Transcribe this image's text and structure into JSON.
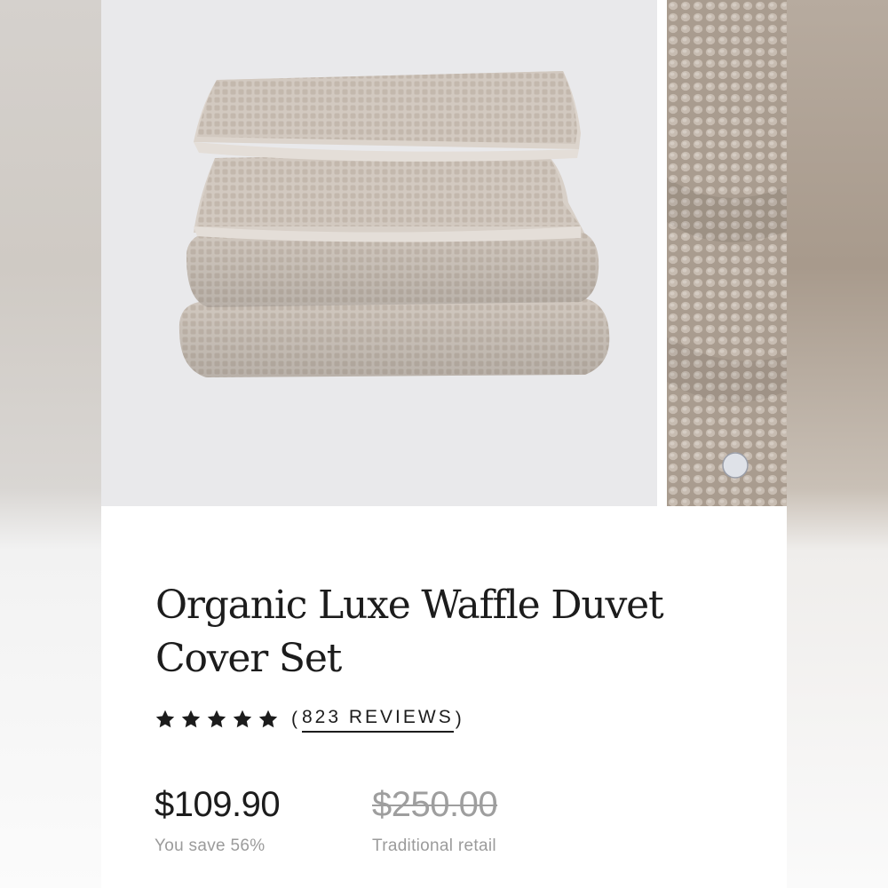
{
  "product": {
    "title": "Organic Luxe Waffle Duvet Cover Set",
    "rating": {
      "stars": 5,
      "reviews_open": "(",
      "reviews_label": "823 REVIEWS",
      "reviews_close": ")"
    },
    "price": {
      "current": "$109.90",
      "savings": "You save 56%",
      "original": "$250.00",
      "original_label": "Traditional retail"
    }
  },
  "colors": {
    "fabric": "#cfc5bb",
    "background": "#e9e9eb",
    "text": "#1c1c1c",
    "muted": "#9b9b9b"
  },
  "icons": [
    "star-icon"
  ]
}
